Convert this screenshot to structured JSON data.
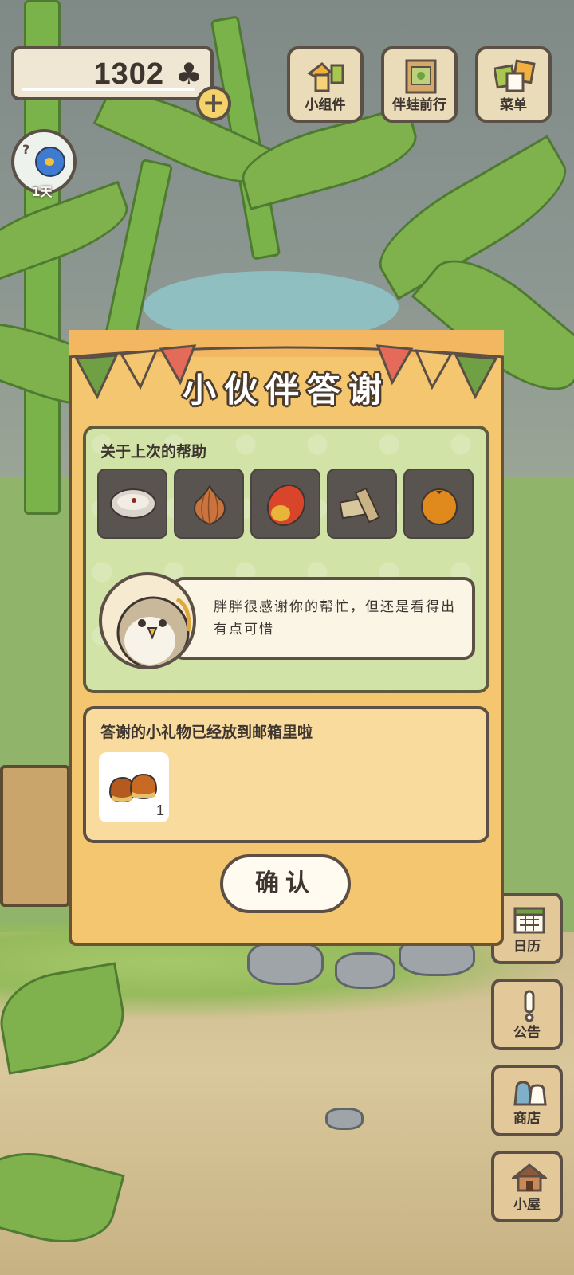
{
  "currency": {
    "amount": "1302",
    "symbol": "♣",
    "icon": "clover-icon"
  },
  "top_buttons": [
    {
      "label": "小组件",
      "icon": "widget-icon"
    },
    {
      "label": "伴蛙前行",
      "icon": "map-icon"
    },
    {
      "label": "菜单",
      "icon": "menu-cards-icon"
    }
  ],
  "day_badge": {
    "label": "1天",
    "mark": "?"
  },
  "side_buttons": [
    {
      "label": "日历",
      "icon": "calendar-icon"
    },
    {
      "label": "公告",
      "icon": "exclamation-icon"
    },
    {
      "label": "商店",
      "icon": "shop-bag-icon"
    },
    {
      "label": "小屋",
      "icon": "house-icon"
    }
  ],
  "modal": {
    "title": "小伙伴答谢",
    "help_section": {
      "title": "关于上次的帮助",
      "items": [
        {
          "name": "bowl-icon"
        },
        {
          "name": "onion-icon"
        },
        {
          "name": "mango-icon"
        },
        {
          "name": "tofu-icon"
        },
        {
          "name": "orange-icon"
        }
      ],
      "message": "胖胖很感谢你的帮忙，但还是看得出有点可惜",
      "speaker_icon": "chubby-bird-avatar"
    },
    "gift_section": {
      "title": "答谢的小礼物已经放到邮箱里啦",
      "item": {
        "name": "chestnut-icon",
        "count": "1"
      }
    },
    "confirm_label": "确认"
  },
  "colors": {
    "modal_bg": "#f5c670",
    "help_panel_bg": "#d2e3a7",
    "gift_panel_bg": "#f9dc9d",
    "outline": "#5c5046",
    "slot_bg": "#595450",
    "bunting_green": "#6fa043",
    "bunting_red": "#e46a5a"
  }
}
